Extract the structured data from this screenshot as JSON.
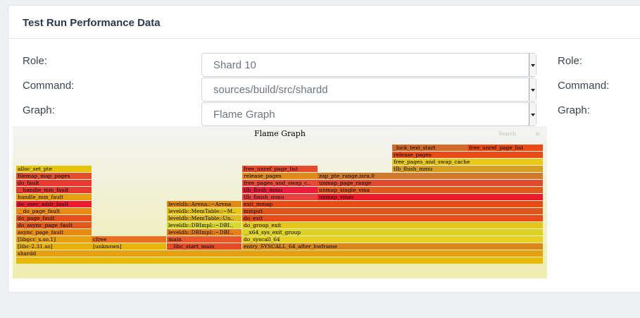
{
  "card": {
    "title": "Test Run Performance Data"
  },
  "form": {
    "role_label": "Role:",
    "command_label": "Command:",
    "graph_label": "Graph:",
    "role_value": "Shard 10",
    "command_value": "sources/build/src/shardd",
    "graph_value": "Flame Graph",
    "right_role_label": "Role:",
    "right_command_label": "Command:",
    "right_graph_label": "Graph:"
  },
  "flame": {
    "title": "Flame Graph",
    "search_label": "Search",
    "ic_label": "ic",
    "frames": [
      {
        "label": "",
        "color": "#e6b800"
      },
      {
        "label": "shardd",
        "color": "#e6a014"
      },
      {
        "label": "[libc-2.31.so]",
        "color": "#e8b00c"
      },
      {
        "label": "[unknown]",
        "color": "#e8b40a"
      },
      {
        "label": "__libc_start_main",
        "color": "#e64a26"
      },
      {
        "label": "entry_SYSCALL_64_after_hwframe",
        "color": "#d8881a"
      },
      {
        "label": "[libgcc_s.so.1]",
        "color": "#e8a010"
      },
      {
        "label": "cfree",
        "color": "#e87020"
      },
      {
        "label": "main",
        "color": "#e8562a"
      },
      {
        "label": "do_syscall_64",
        "color": "#e8d020"
      },
      {
        "label": "async_page_fault",
        "color": "#e88a12"
      },
      {
        "label": "leveldb::DBImpl::~DBI..",
        "color": "#e6801a"
      },
      {
        "label": "__x64_sys_exit_group",
        "color": "#dcd024"
      },
      {
        "label": "do_async_page_fault",
        "color": "#e05a20"
      },
      {
        "label": "leveldb::DBImpl::~DBI..",
        "color": "#d8d830"
      },
      {
        "label": "do_group_exit",
        "color": "#e6c61a"
      },
      {
        "label": "do_page_fault",
        "color": "#e6501a"
      },
      {
        "label": "leveldb::MemTable::Un..",
        "color": "#e0b820"
      },
      {
        "label": "do_exit",
        "color": "#e84a1a"
      },
      {
        "label": "__do_page_fault",
        "color": "#e88a14"
      },
      {
        "label": "leveldb::MemTable::~M..",
        "color": "#e8c616"
      },
      {
        "label": "mmput",
        "color": "#e0561a"
      },
      {
        "label": "do_user_addr_fault",
        "color": "#ee1a30"
      },
      {
        "label": "leveldb::Arena::~Arena",
        "color": "#e08a18"
      },
      {
        "label": "exit_mmap",
        "color": "#e84a14"
      },
      {
        "label": "handle_mm_fault",
        "color": "#e8a010"
      },
      {
        "label": "tlb_finish_mmu",
        "color": "#ea4040"
      },
      {
        "label": "unmap_vmas",
        "color": "#ee1a2a"
      },
      {
        "label": "__handle_mm_fault",
        "color": "#e83a30"
      },
      {
        "label": "tlb_flush_mmu",
        "color": "#ee1c3c"
      },
      {
        "label": "unmap_single_vma",
        "color": "#e05a1c"
      },
      {
        "label": "do_fault",
        "color": "#e83a32"
      },
      {
        "label": "free_pages_and_swap_c..",
        "color": "#e84a3a"
      },
      {
        "label": "unmap_page_range",
        "color": "#e04a30"
      },
      {
        "label": "filemap_map_pages",
        "color": "#e0502a"
      },
      {
        "label": "release_pages",
        "color": "#e08a18"
      },
      {
        "label": "zap_pte_range.isra.0",
        "color": "#d07a30"
      },
      {
        "label": "alloc_set_pte",
        "color": "#e6c40a"
      },
      {
        "label": "free_unref_page_list",
        "color": "#e84a2e"
      },
      {
        "label": "tlb_flush_mmu",
        "color": "#d8a020"
      },
      {
        "label": "free_pages_and_swap_cache",
        "color": "#e8c818"
      },
      {
        "label": "release_pages",
        "color": "#e84a16"
      },
      {
        "label": "_lock_text_start",
        "color": "#d06a28"
      },
      {
        "label": "free_unref_page_list",
        "color": "#e84a14"
      }
    ]
  }
}
